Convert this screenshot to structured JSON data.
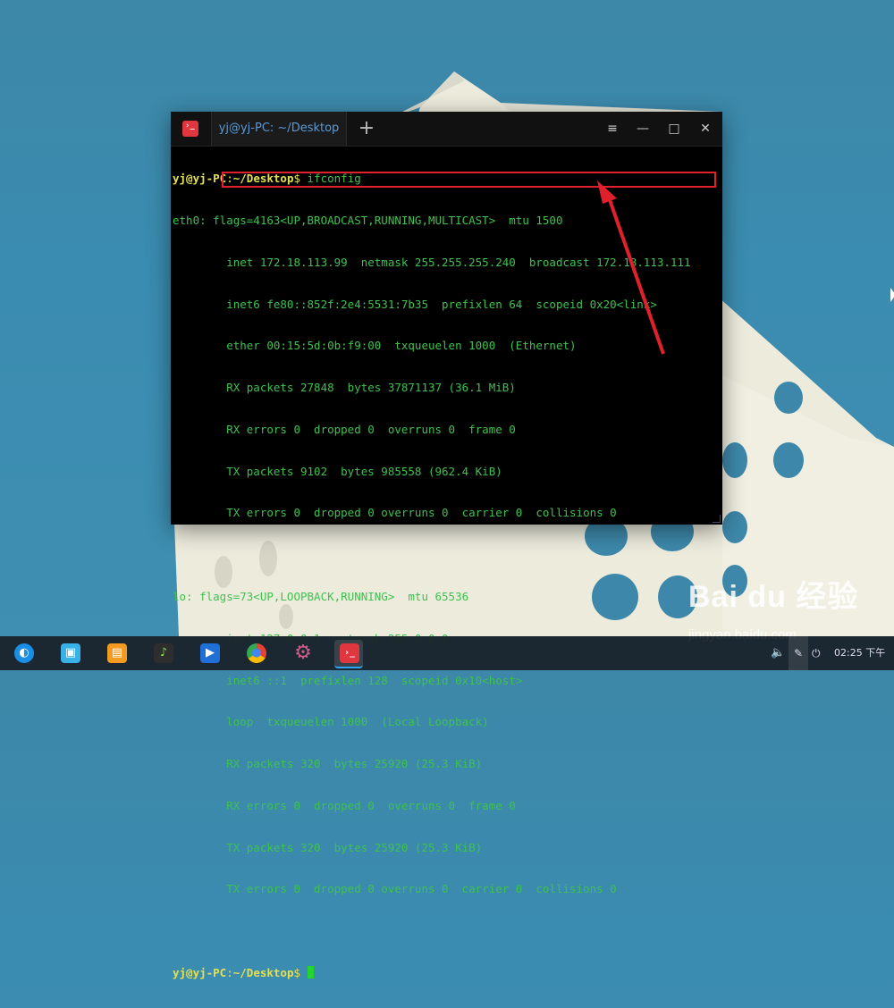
{
  "window": {
    "tab_title": "yj@yj-PC: ~/Desktop",
    "new_tab_symbol": "+",
    "menu_symbol": "≡",
    "minimize_symbol": "—",
    "maximize_symbol": "□",
    "close_symbol": "✕"
  },
  "terminal": {
    "prompt_user": "yj@yj-PC",
    "prompt_path": "~/Desktop",
    "prompt_suffix": "$ ",
    "command": "ifconfig",
    "output": [
      "eth0: flags=4163<UP,BROADCAST,RUNNING,MULTICAST>  mtu 1500",
      "        inet 172.18.113.99  netmask 255.255.255.240  broadcast 172.18.113.111",
      "        inet6 fe80::852f:2e4:5531:7b35  prefixlen 64  scopeid 0x20<link>",
      "        ether 00:15:5d:0b:f9:00  txqueuelen 1000  (Ethernet)",
      "        RX packets 27848  bytes 37871137 (36.1 MiB)",
      "        RX errors 0  dropped 0  overruns 0  frame 0",
      "        TX packets 9102  bytes 985558 (962.4 KiB)",
      "        TX errors 0  dropped 0 overruns 0  carrier 0  collisions 0",
      "",
      "lo: flags=73<UP,LOOPBACK,RUNNING>  mtu 65536",
      "        inet 127.0.0.1  netmask 255.0.0.0",
      "        inet6 ::1  prefixlen 128  scopeid 0x10<host>",
      "        loop  txqueuelen 1000  (Local Loopback)",
      "        RX packets 320  bytes 25920 (25.3 KiB)",
      "        RX errors 0  dropped 0  overruns 0  frame 0",
      "        TX packets 320  bytes 25920 (25.3 KiB)",
      "        TX errors 0  dropped 0 overruns 0  carrier 0  collisions 0",
      ""
    ]
  },
  "taskbar": {
    "apps": [
      {
        "name": "launcher-icon",
        "glyph": "◐",
        "color": "#1a8fe8"
      },
      {
        "name": "app-store-icon",
        "glyph": "▣",
        "color": "#37b1e6"
      },
      {
        "name": "file-manager-icon",
        "glyph": "▤",
        "color": "#f39a21"
      },
      {
        "name": "music-icon",
        "glyph": "♪",
        "color": "#2e2e2e"
      },
      {
        "name": "video-icon",
        "glyph": "▶",
        "color": "#1f6fd6"
      },
      {
        "name": "chrome-icon",
        "glyph": "●",
        "color": "#e94235"
      },
      {
        "name": "settings-icon",
        "glyph": "⚙",
        "color": "#d05c8a"
      },
      {
        "name": "terminal-icon",
        "glyph": "›_",
        "color": "#e0363f"
      }
    ],
    "time": "02:25 下午"
  },
  "watermark": {
    "logo": "Bai du 经验",
    "url": "jingyan.baidu.com"
  },
  "colors": {
    "terminal_text": "#3fc14f",
    "prompt": "#e4e052",
    "annotation_red": "#e0212b",
    "tab_text": "#5a9ad6"
  }
}
